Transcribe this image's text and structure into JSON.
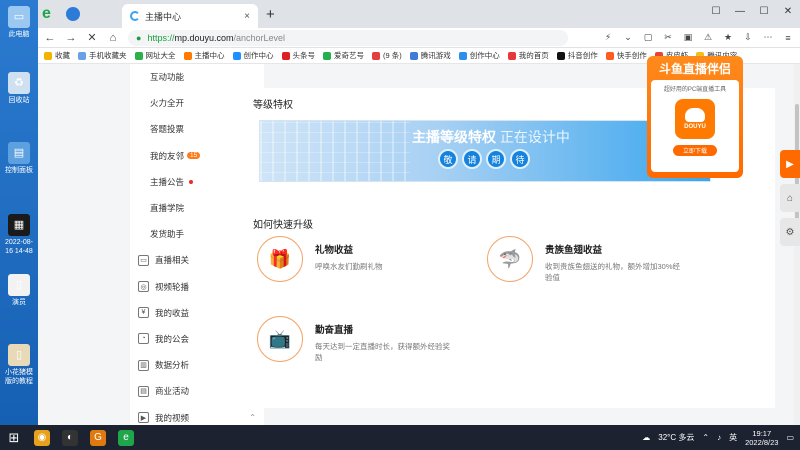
{
  "desktop": {
    "icons": [
      {
        "label": "此电脑",
        "glyph": "▭",
        "color": "#9bc8f0"
      },
      {
        "label": "回收站",
        "glyph": "♻",
        "color": "#cfe1f1"
      },
      {
        "label": "控制面板",
        "glyph": "▤",
        "color": "#5da0e0"
      },
      {
        "label": "2022-08-16 14-48",
        "glyph": "▦",
        "color": "#1a1a1a"
      },
      {
        "label": "演员",
        "glyph": "▯",
        "color": "#f2f2f2"
      },
      {
        "label": "小花猪模版的教程",
        "glyph": "▯",
        "color": "#e8d9b8"
      }
    ]
  },
  "browser": {
    "tab_title": "主播中心",
    "tab_close": "×",
    "new_tab": "+",
    "window_controls": [
      "☐",
      "—",
      "☐",
      "✕"
    ],
    "address": {
      "protocol": "https://",
      "host": "mp.douyu.com",
      "path": "/anchorLevel"
    },
    "nav_buttons": [
      "←",
      "→",
      "✕",
      "⌂"
    ],
    "toolbar_icons": [
      "⚡",
      "⌄",
      "▢",
      "✂",
      "▣",
      "⚠",
      "★",
      "⇩",
      "⋯",
      "≡"
    ],
    "bookmarks": [
      {
        "label": "收藏",
        "color": "#f3b400"
      },
      {
        "label": "手机收藏夹",
        "color": "#6aa0e6"
      },
      {
        "label": "网址大全",
        "color": "#2bb04a"
      },
      {
        "label": "主播中心",
        "color": "#ff7a00"
      },
      {
        "label": "创作中心",
        "color": "#1e90ff"
      },
      {
        "label": "头条号",
        "color": "#e02020"
      },
      {
        "label": "爱奇艺号",
        "color": "#21b14e"
      },
      {
        "label": "(9 条)",
        "color": "#e04040"
      },
      {
        "label": "腾讯游戏",
        "color": "#3f7cd8"
      },
      {
        "label": "创作中心",
        "color": "#2c90e8"
      },
      {
        "label": "我的首页",
        "color": "#e8363a"
      },
      {
        "label": "抖音创作",
        "color": "#111111"
      },
      {
        "label": "快手创作",
        "color": "#ff5a1f"
      },
      {
        "label": "皮皮虾",
        "color": "#e6443a"
      },
      {
        "label": "腾讯内容",
        "color": "#f0c020"
      }
    ]
  },
  "sidebar": {
    "items": [
      {
        "label": "互动功能",
        "type": "sub"
      },
      {
        "label": "火力全开",
        "type": "sub"
      },
      {
        "label": "答题投票",
        "type": "sub"
      },
      {
        "label": "我的友邻",
        "type": "sub",
        "badge": "15"
      },
      {
        "label": "主播公告",
        "type": "sub",
        "dot": true
      },
      {
        "label": "直播学院",
        "type": "sub"
      },
      {
        "label": "发货助手",
        "type": "sub"
      },
      {
        "label": "直播相关",
        "type": "group",
        "icon": "▭",
        "chevron": "⌃"
      },
      {
        "label": "视频轮播",
        "type": "group",
        "icon": "◎"
      },
      {
        "label": "我的收益",
        "type": "group",
        "icon": "¥",
        "chevron": "⌃"
      },
      {
        "label": "我的公会",
        "type": "group",
        "icon": "◔",
        "chevron": "⌃"
      },
      {
        "label": "数据分析",
        "type": "group",
        "icon": "▥",
        "chevron": "⌃"
      },
      {
        "label": "商业活动",
        "type": "group",
        "icon": "▤",
        "chevron": "⌃"
      },
      {
        "label": "我的视频",
        "type": "group",
        "icon": "▶",
        "chevron": "⌃"
      }
    ]
  },
  "main": {
    "privilege_title": "等级特权",
    "banner": {
      "headline": "主播等级特权",
      "headline_soft": "正在设计中",
      "wait_chars": [
        "敬",
        "请",
        "期",
        "待"
      ]
    },
    "upgrade_title": "如何快速升级",
    "features": [
      {
        "icon": "🎁",
        "title": "礼物收益",
        "desc": "呼唤水友们勤刷礼物"
      },
      {
        "icon": "🦈",
        "title": "贵族鱼翅收益",
        "desc": "收到贵族鱼翅送的礼物，额外增加30%经验值"
      },
      {
        "icon": "📺",
        "title": "勤奋直播",
        "desc": "每天达到一定直播时长，获得额外经验奖励"
      }
    ]
  },
  "ad": {
    "title": "斗鱼直播伴侣",
    "subtitle": "超好用的PC端直播工具",
    "logo_text": "DOUYU",
    "button": "立即下载"
  },
  "right_tools": [
    "▶",
    "⌂",
    "⚙"
  ],
  "taskbar": {
    "apps": [
      {
        "glyph": "⊞",
        "color": "#1c2230"
      },
      {
        "glyph": "◉",
        "color": "#e7a11c"
      },
      {
        "glyph": "◐",
        "color": "#333333"
      },
      {
        "glyph": "G",
        "color": "#e07a10"
      },
      {
        "glyph": "e",
        "color": "#1fa64b"
      }
    ],
    "weather": "32°C 多云",
    "ime": "英",
    "time": "19:17",
    "date": "2022/8/23"
  }
}
